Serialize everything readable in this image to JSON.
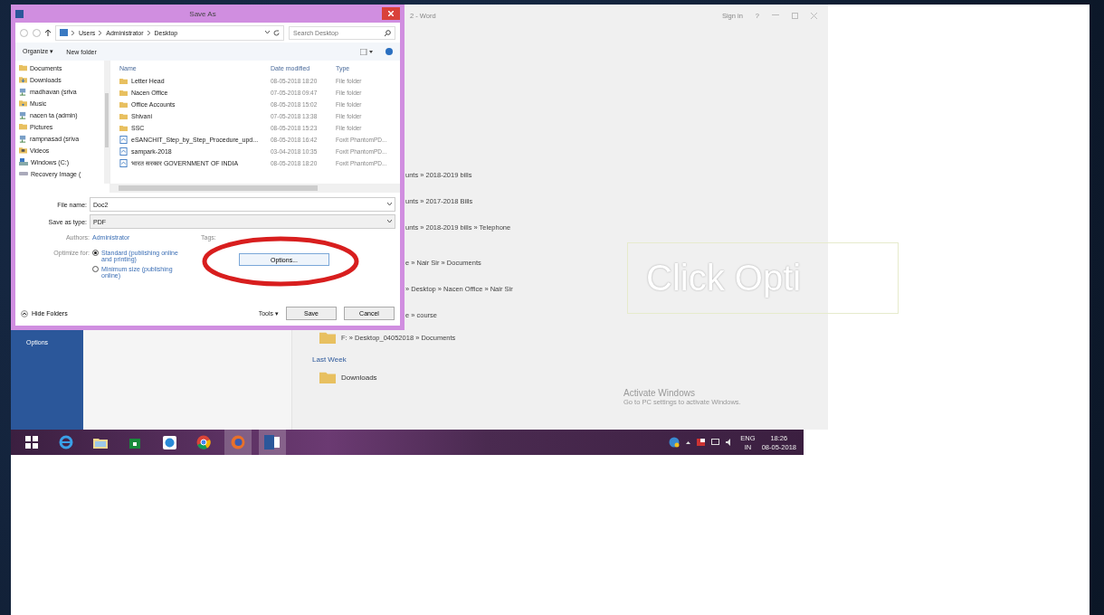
{
  "word": {
    "title": "2 - Word",
    "sign_in": "Sign in",
    "help": "?",
    "sidebar": [
      {
        "label": "Options"
      }
    ],
    "recent_groups": [
      {
        "items": [
          {
            "kind": "path",
            "path": "unts » 2018-2019 bills"
          },
          {
            "kind": "path",
            "path": "unts » 2017-2018 Bills"
          },
          {
            "kind": "path",
            "path": "unts » 2018-2019 bills » Telephone"
          }
        ]
      },
      {
        "items": [
          {
            "kind": "path",
            "path": "e » Nair Sir » Documents"
          },
          {
            "kind": "path",
            "path": "» Desktop » Nacen Office » Nair Sir"
          },
          {
            "kind": "path",
            "path": "e » course"
          },
          {
            "kind": "folder",
            "path": "F: » Desktop_04052018 » Documents"
          }
        ]
      },
      {
        "heading": "Last Week",
        "items": [
          {
            "kind": "folder",
            "name": "Downloads"
          }
        ]
      }
    ],
    "activation": {
      "title": "Activate Windows",
      "text": "Go to PC settings to activate Windows."
    }
  },
  "dialog": {
    "title": "Save As",
    "breadcrumb": [
      "Users",
      "Administrator",
      "Desktop"
    ],
    "search": {
      "placeholder": "Search Desktop"
    },
    "toolbar": [
      "Organize ▾",
      "New folder"
    ],
    "nav": [
      {
        "kind": "folder",
        "label": "Documents"
      },
      {
        "kind": "download",
        "label": "Downloads"
      },
      {
        "kind": "network",
        "label": "madhavan (sriva"
      },
      {
        "kind": "music",
        "label": "Music"
      },
      {
        "kind": "network",
        "label": "nacen ta (admin)"
      },
      {
        "kind": "folder",
        "label": "Pictures"
      },
      {
        "kind": "network",
        "label": "rampnasad (sriva"
      },
      {
        "kind": "video",
        "label": "Videos"
      },
      {
        "kind": "drive",
        "label": "Windows (C:)"
      },
      {
        "kind": "recovery",
        "label": "Recovery Image ("
      }
    ],
    "columns": [
      "Name",
      "Date modified",
      "Type"
    ],
    "files": [
      {
        "kind": "folder",
        "name": "Letter Head",
        "date": "08-05-2018 18:20",
        "type": "File folder"
      },
      {
        "kind": "folder",
        "name": "Nacen Office",
        "date": "07-05-2018 09:47",
        "type": "File folder"
      },
      {
        "kind": "folder",
        "name": "Office Accounts",
        "date": "08-05-2018 15:02",
        "type": "File folder"
      },
      {
        "kind": "folder",
        "name": "Shivani",
        "date": "07-05-2018 13:38",
        "type": "File folder"
      },
      {
        "kind": "folder",
        "name": "SSC",
        "date": "08-05-2018 15:23",
        "type": "File folder"
      },
      {
        "kind": "pdf",
        "name": "eSANCHIT_Step_by_Step_Procedure_upd...",
        "date": "08-05-2018 16:42",
        "type": "Foxit PhantomPD..."
      },
      {
        "kind": "pdf",
        "name": "sampark-2018",
        "date": "03-04-2018 10:35",
        "type": "Foxit PhantomPD..."
      },
      {
        "kind": "pdf",
        "name": "भारत सरकार GOVERNMENT OF INDIA",
        "date": "08-05-2018 18:20",
        "type": "Foxit PhantomPD..."
      }
    ],
    "file_name": {
      "label": "File name:",
      "value": "Doc2"
    },
    "save_type": {
      "label": "Save as type:",
      "value": "PDF"
    },
    "authors": {
      "label": "Authors:",
      "value": "Administrator"
    },
    "tags": {
      "label": "Tags:"
    },
    "optimize": {
      "label": "Optimize for:",
      "options": [
        {
          "label": "Standard (publishing online and printing)",
          "selected": true
        },
        {
          "label": "Minimum size (publishing online)",
          "selected": false
        }
      ]
    },
    "options_button": "Options...",
    "hide_folders": "Hide Folders",
    "tools": "Tools ▾",
    "save": "Save",
    "cancel": "Cancel"
  },
  "taskbar": {
    "apps": [
      {
        "kind": "start",
        "running": false
      },
      {
        "kind": "ie",
        "running": false
      },
      {
        "kind": "explorer",
        "running": false
      },
      {
        "kind": "store",
        "running": false
      },
      {
        "kind": "skype",
        "running": false
      },
      {
        "kind": "chrome",
        "running": false
      },
      {
        "kind": "firefox",
        "running": true
      },
      {
        "kind": "word",
        "running": true
      }
    ],
    "tray": {
      "language": "ENG",
      "region": "IN",
      "time": "18:26",
      "date": "08-05-2018"
    }
  },
  "annotation": {
    "text": "Click Opti"
  }
}
